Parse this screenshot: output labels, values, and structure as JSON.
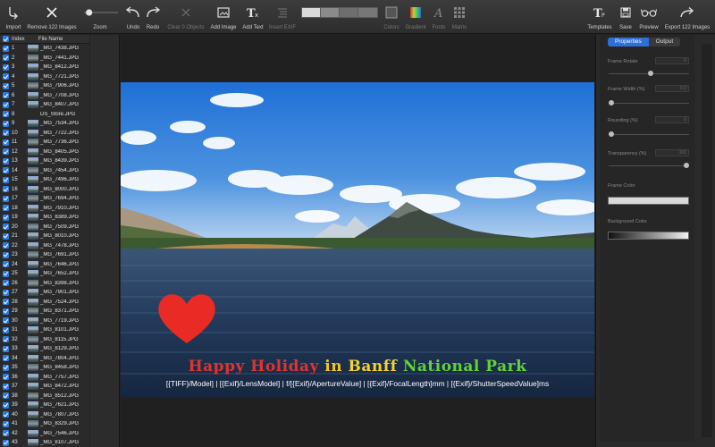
{
  "toolbar": {
    "import": "Import",
    "remove": "Remove 122 Images",
    "zoom": "Zoom",
    "undo": "Undo",
    "redo": "Redo",
    "clear": "Clear 0 Objects",
    "add_image": "Add Image",
    "add_text": "Add Text",
    "insert_exif": "Insert EXIF",
    "colors": "Colors",
    "gradient": "Gradient",
    "fonts": "Fonts",
    "matrix": "Matrix",
    "templates": "Templates",
    "save": "Save",
    "preview": "Preview",
    "export": "Export 122 Images",
    "zoom_level": 0.15
  },
  "list": {
    "col_index": "Index",
    "col_name": "File Name",
    "rows": [
      {
        "i": "1",
        "n": "_MG_7438.JPG"
      },
      {
        "i": "2",
        "n": "_MG_7441.JPG"
      },
      {
        "i": "3",
        "n": "_MG_8412.JPG"
      },
      {
        "i": "4",
        "n": "_MG_7721.JPG"
      },
      {
        "i": "5",
        "n": "_MG_7906.JPG"
      },
      {
        "i": "6",
        "n": "_MG_7708.JPG"
      },
      {
        "i": "7",
        "n": "_MG_8407.JPG"
      },
      {
        "i": "8",
        "n": "DS_Store.JPG"
      },
      {
        "i": "9",
        "n": "_MG_7534.JPG"
      },
      {
        "i": "10",
        "n": "_MG_7722.JPG"
      },
      {
        "i": "11",
        "n": "_MG_7736.JPG"
      },
      {
        "i": "12",
        "n": "_MG_8405.JPG"
      },
      {
        "i": "13",
        "n": "_MG_8439.JPG"
      },
      {
        "i": "14",
        "n": "_MG_7454.JPG"
      },
      {
        "i": "15",
        "n": "_MG_7496.JPG"
      },
      {
        "i": "16",
        "n": "_MG_8000.JPG"
      },
      {
        "i": "17",
        "n": "_MG_7694.JPG"
      },
      {
        "i": "18",
        "n": "_MG_7910.JPG"
      },
      {
        "i": "19",
        "n": "_MG_8389.JPG"
      },
      {
        "i": "20",
        "n": "_MG_7509.JPG"
      },
      {
        "i": "21",
        "n": "_MG_8010.JPG"
      },
      {
        "i": "22",
        "n": "_MG_7478.JPG"
      },
      {
        "i": "23",
        "n": "_MG_7691.JPG"
      },
      {
        "i": "24",
        "n": "_MG_7646.JPG"
      },
      {
        "i": "25",
        "n": "_MG_7652.JPG"
      },
      {
        "i": "26",
        "n": "_MG_8398.JPG"
      },
      {
        "i": "27",
        "n": "_MG_7901.JPG"
      },
      {
        "i": "28",
        "n": "_MG_7524.JPG"
      },
      {
        "i": "29",
        "n": "_MG_8371.JPG"
      },
      {
        "i": "30",
        "n": "_MG_7719.JPG"
      },
      {
        "i": "31",
        "n": "_MG_8101.JPG"
      },
      {
        "i": "32",
        "n": "_MG_8115.JPG"
      },
      {
        "i": "33",
        "n": "_MG_8129.JPG"
      },
      {
        "i": "34",
        "n": "_MG_7804.JPG"
      },
      {
        "i": "35",
        "n": "_MG_8458.JPG"
      },
      {
        "i": "36",
        "n": "_MG_7757.JPG"
      },
      {
        "i": "37",
        "n": "_MG_8472.JPG"
      },
      {
        "i": "38",
        "n": "_MG_8512.JPG"
      },
      {
        "i": "39",
        "n": "_MG_7621.JPG"
      },
      {
        "i": "40",
        "n": "_MG_7807.JPG"
      },
      {
        "i": "41",
        "n": "_MG_8329.JPG"
      },
      {
        "i": "42",
        "n": "_MG_7546.JPG"
      },
      {
        "i": "43",
        "n": "_MG_8107.JPG"
      }
    ]
  },
  "canvas": {
    "caption_words": [
      {
        "t": "Happy Holiday ",
        "c": "#e0342f"
      },
      {
        "t": "in ",
        "c": "#f0c419"
      },
      {
        "t": "Banff ",
        "c": "#f2d22e"
      },
      {
        "t": "National Park",
        "c": "#62d23a"
      }
    ],
    "exif_line": "[{TIFF}/Model] | [{Exif}/LensModel] | f/[{Exif}/ApertureValue] | [{Exif}/FocalLength]mm | [{Exif}/ShutterSpeedValue]ms",
    "heart_color": "#ea2b25"
  },
  "panel": {
    "tab_properties": "Properties",
    "tab_output": "Output",
    "frame_rotate": "Frame Rotate",
    "frame_width": "Frame Width (%)",
    "rounding": "Rounding (%)",
    "transparency": "Transparency (%)",
    "frame_color": "Frame Color",
    "background_color": "Background Color",
    "frame_rotate_value": "0",
    "frame_width_value": "0.0",
    "rounding_value": "0",
    "transparency_value": "100",
    "accent": "#2f6fd6"
  }
}
